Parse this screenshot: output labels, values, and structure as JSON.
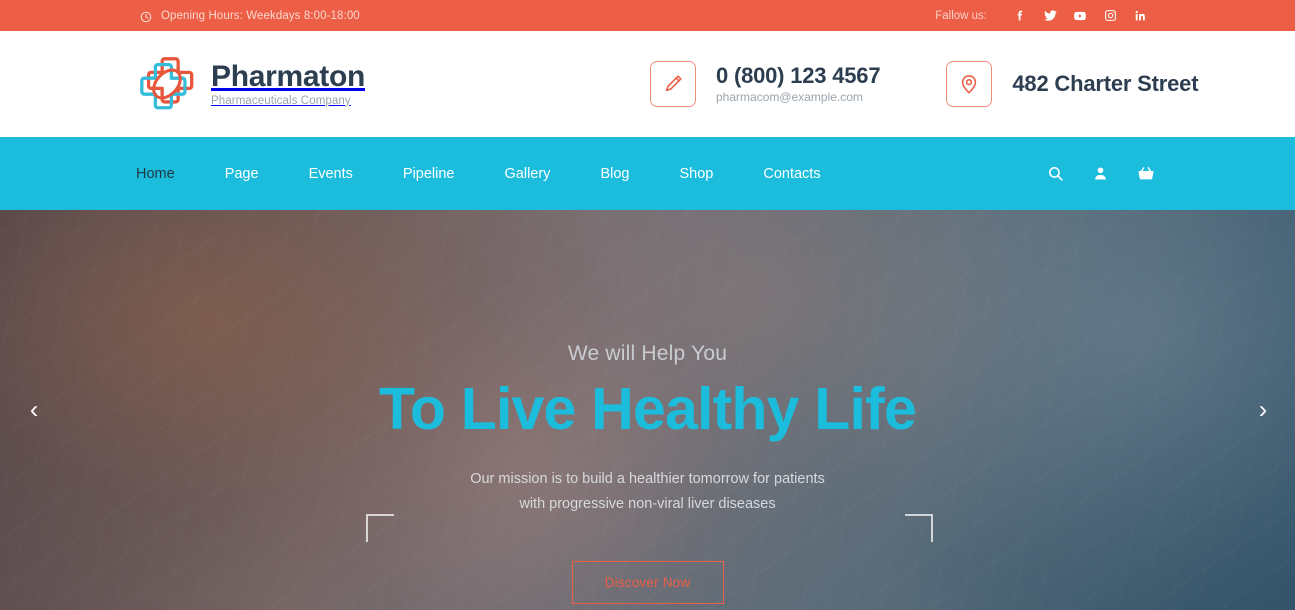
{
  "colors": {
    "accent_orange": "#ec5e46",
    "accent_cyan": "#1bbcdc",
    "dark_navy": "#2c3e50",
    "muted_grey": "#9aa4ad"
  },
  "topbar": {
    "clock_icon": "clock-icon",
    "opening_hours": "Opening Hours: Weekdays 8:00-18:00",
    "follow_label": "Fallow us:",
    "social": [
      {
        "name": "facebook-icon",
        "label": "Facebook"
      },
      {
        "name": "twitter-icon",
        "label": "Twitter"
      },
      {
        "name": "youtube-icon",
        "label": "YouTube"
      },
      {
        "name": "instagram-icon",
        "label": "Instagram"
      },
      {
        "name": "linkedin-icon",
        "label": "LinkedIn"
      }
    ]
  },
  "header": {
    "logo": {
      "icon": "pharmaton-cross-logo",
      "title": "Pharmaton",
      "subtitle": "Pharmaceuticals Company"
    },
    "phone_block": {
      "icon": "pencil-icon",
      "phone": "0 (800) 123 4567",
      "email": "pharmacom@example.com"
    },
    "address_block": {
      "icon": "map-pin-icon",
      "address": "482 Charter Street"
    }
  },
  "nav": {
    "items": [
      {
        "label": "Home",
        "active": true
      },
      {
        "label": "Page",
        "active": false
      },
      {
        "label": "Events",
        "active": false
      },
      {
        "label": "Pipeline",
        "active": false
      },
      {
        "label": "Gallery",
        "active": false
      },
      {
        "label": "Blog",
        "active": false
      },
      {
        "label": "Shop",
        "active": false
      },
      {
        "label": "Contacts",
        "active": false
      }
    ],
    "icons": [
      {
        "name": "search-icon"
      },
      {
        "name": "user-icon"
      },
      {
        "name": "basket-icon"
      }
    ]
  },
  "hero": {
    "pretitle": "We will Help You",
    "title": "To Live Healthy Life",
    "description_line1": "Our mission is to build a healthier tomorrow for patients",
    "description_line2": "with progressive non-viral liver diseases",
    "cta_label": "Discover Now",
    "prev_arrow": "‹",
    "next_arrow": "›"
  }
}
